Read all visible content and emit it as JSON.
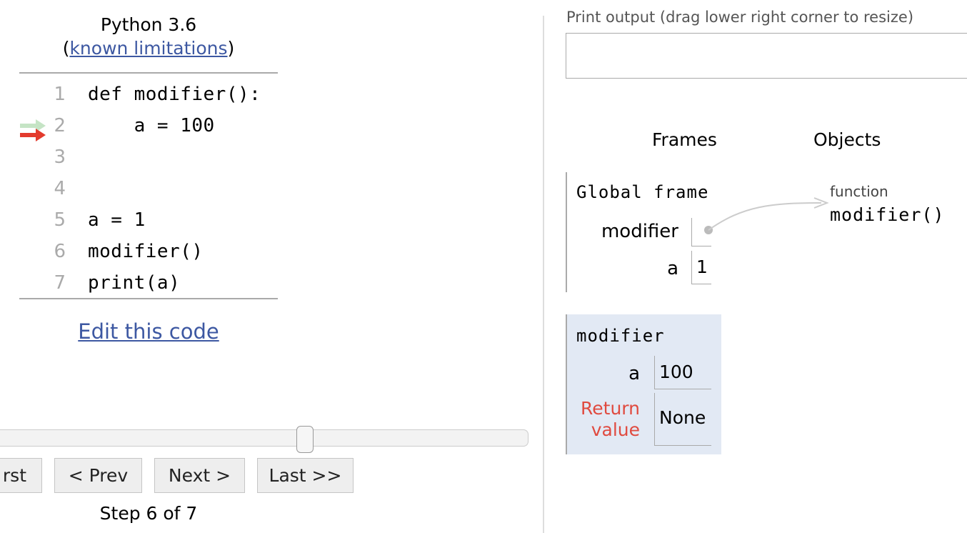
{
  "header": {
    "language": "Python 3.6",
    "open_paren": "(",
    "limitations_link": "known limitations",
    "close_paren": ")"
  },
  "code": {
    "lines": [
      {
        "num": "1",
        "text": "def modifier():"
      },
      {
        "num": "2",
        "text": "    a = 100"
      },
      {
        "num": "3",
        "text": ""
      },
      {
        "num": "4",
        "text": ""
      },
      {
        "num": "5",
        "text": "a = 1"
      },
      {
        "num": "6",
        "text": "modifier()"
      },
      {
        "num": "7",
        "text": "print(a)"
      }
    ],
    "prev_line_arrow_color": "#c5e4c5",
    "curr_line_arrow_color": "#e33b2d",
    "arrow_line": 2
  },
  "edit_link": "Edit this code",
  "slider": {
    "step": 6,
    "total": 7
  },
  "nav": {
    "first": "rst",
    "prev": "< Prev",
    "next": "Next >",
    "last": "Last >>"
  },
  "step_label": "Step 6 of 7",
  "output": {
    "label": "Print output (drag lower right corner to resize)",
    "content": ""
  },
  "viz": {
    "frames_header": "Frames",
    "objects_header": "Objects",
    "global_frame": {
      "title": "Global frame",
      "vars": [
        {
          "name": "modifier",
          "value": ""
        },
        {
          "name": "a",
          "value": "1"
        }
      ]
    },
    "modifier_frame": {
      "title": "modifier",
      "vars": [
        {
          "name": "a",
          "value": "100"
        }
      ],
      "return_label_1": "Return",
      "return_label_2": "value",
      "return_value": "None"
    },
    "object": {
      "type": "function",
      "name": "modifier()"
    },
    "colors": {
      "link": "#3d58a2",
      "frame_bg": "#e2e9f4",
      "return_label": "#e04a3f"
    }
  }
}
